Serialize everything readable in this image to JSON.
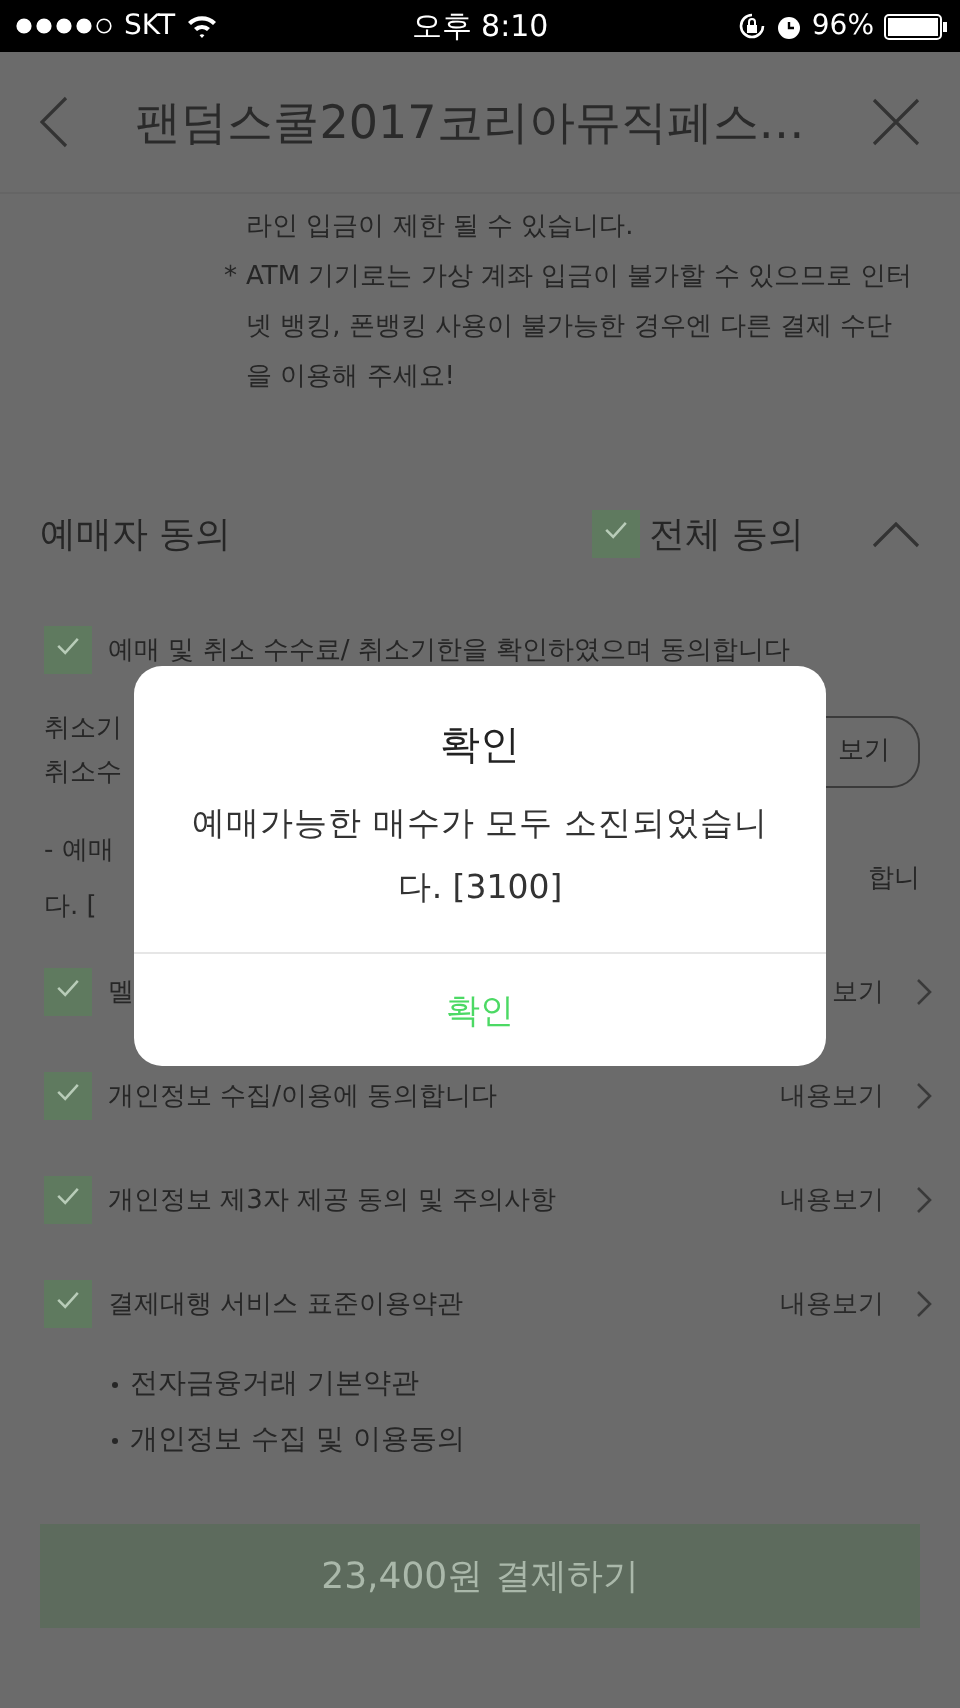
{
  "status_bar": {
    "carrier": "SKT",
    "time": "오후 8:10",
    "battery": "96%"
  },
  "header": {
    "title": "팬덤스쿨2017코리아뮤직페스…"
  },
  "notice": {
    "lines": [
      {
        "kind": "plain",
        "text": "라인 입금이 제한 될 수 있습니다."
      },
      {
        "kind": "star",
        "mark": "*",
        "text": "ATM 기기로는 가상 계좌 입금이 불가할 수 있으므로 인터넷 뱅킹, 폰뱅킹 사용이 불가능한 경우엔 다른 결제 수단을 이용해 주세요!"
      }
    ]
  },
  "agreement": {
    "title": "예매자 동의",
    "all": {
      "label": "전체 동의",
      "checked": true
    },
    "expanded": true,
    "rows": [
      {
        "kind": "check",
        "checked": true,
        "label": "예매 및 취소 수수료/ 취소기한을 확인하였으며 동의합니다"
      },
      {
        "kind": "partial",
        "left": [
          "취소기",
          "취소수"
        ],
        "button": "보기"
      },
      {
        "kind": "partial",
        "left": [
          "- 예매",
          "다. ["
        ],
        "right": "합니"
      },
      {
        "kind": "check",
        "checked": true,
        "label": "멜",
        "link": "보기"
      },
      {
        "kind": "check",
        "checked": true,
        "label": "개인정보 수집/이용에 동의합니다",
        "link": "내용보기"
      },
      {
        "kind": "check",
        "checked": true,
        "label": "개인정보 제3자 제공 동의 및 주의사항",
        "link": "내용보기"
      },
      {
        "kind": "check",
        "checked": true,
        "label": "결제대행 서비스 표준이용약관",
        "link": "내용보기",
        "sub": [
          "전자금융거래 기본약관",
          "개인정보 수집 및 이용동의"
        ]
      }
    ]
  },
  "pay_button": "23,400원 결제하기",
  "dialog": {
    "title": "확인",
    "message": "예매가능한 매수가 모두 소진되었습니다. [3100]",
    "button": "확인"
  }
}
